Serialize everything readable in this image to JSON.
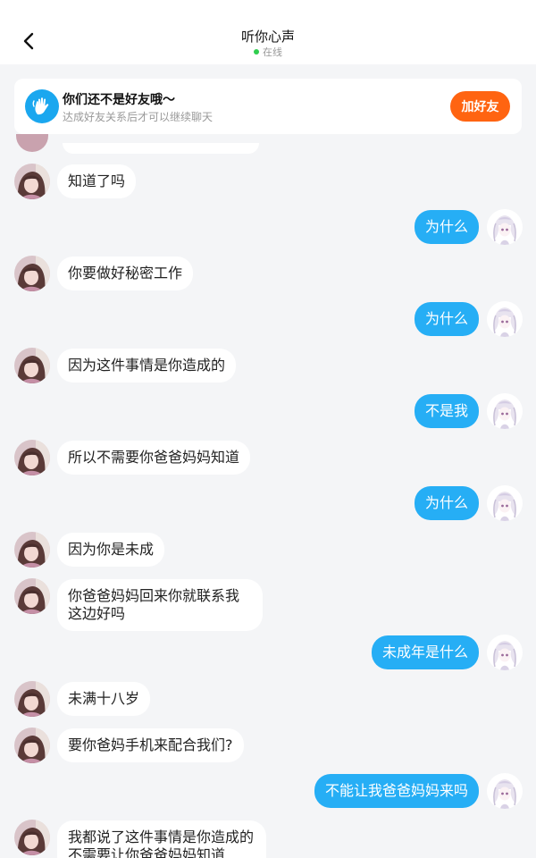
{
  "header": {
    "title": "听你心声",
    "status": "在线",
    "back_icon": "chevron-left-icon"
  },
  "banner": {
    "icon": "wave-hand-icon",
    "title": "你们还不是好友哦～",
    "subtitle": "达成好友关系后才可以继续聊天",
    "button_label": "加好友"
  },
  "colors": {
    "accent_blue": "#26aef5",
    "button_orange": "#ff6411",
    "online_green": "#2fce4e",
    "background": "#f4f5f7"
  },
  "messages": [
    {
      "side": "left",
      "text": "知道了吗"
    },
    {
      "side": "right",
      "text": "为什么"
    },
    {
      "side": "left",
      "text": "你要做好秘密工作"
    },
    {
      "side": "right",
      "text": "为什么"
    },
    {
      "side": "left",
      "text": "因为这件事情是你造成的"
    },
    {
      "side": "right",
      "text": "不是我"
    },
    {
      "side": "left",
      "text": "所以不需要你爸爸妈妈知道"
    },
    {
      "side": "right",
      "text": "为什么"
    },
    {
      "side": "left",
      "text": "因为你是未成"
    },
    {
      "side": "left",
      "text": "你爸爸妈妈回来你就联系我这边好吗"
    },
    {
      "side": "right",
      "text": "未成年是什么"
    },
    {
      "side": "left",
      "text": "未满十八岁"
    },
    {
      "side": "left",
      "text": "要你爸妈手机来配合我们?"
    },
    {
      "side": "right",
      "text": "不能让我爸爸妈妈来吗"
    },
    {
      "side": "left",
      "text": "我都说了这件事情是你造成的不需要让你爸爸妈妈知道"
    }
  ]
}
